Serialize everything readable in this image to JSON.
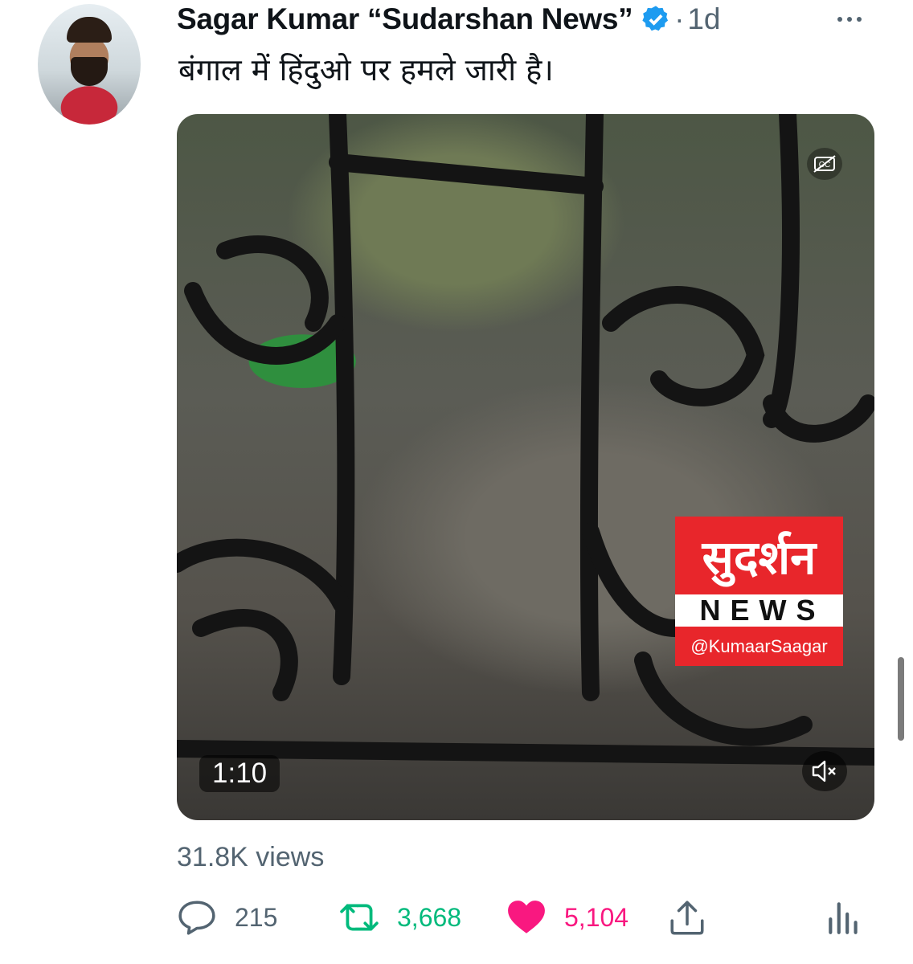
{
  "tweet": {
    "author": "Sagar Kumar “Sudarshan News”",
    "separator": "·",
    "time": "1d",
    "text": "बंगाल में हिंदुओ पर हमले जारी है।"
  },
  "media": {
    "logo_title": "सुदर्शन",
    "logo_news": "NEWS",
    "logo_handle": "@KumaarSaagar",
    "duration": "1:10",
    "cc_label": "CC"
  },
  "stats": {
    "views": "31.8K views",
    "replies": "215",
    "retweets": "3,668",
    "likes": "5,104"
  },
  "colors": {
    "verified": "#1d9bf0",
    "retweet": "#00ba7c",
    "like": "#f91880",
    "secondary": "#536471"
  }
}
